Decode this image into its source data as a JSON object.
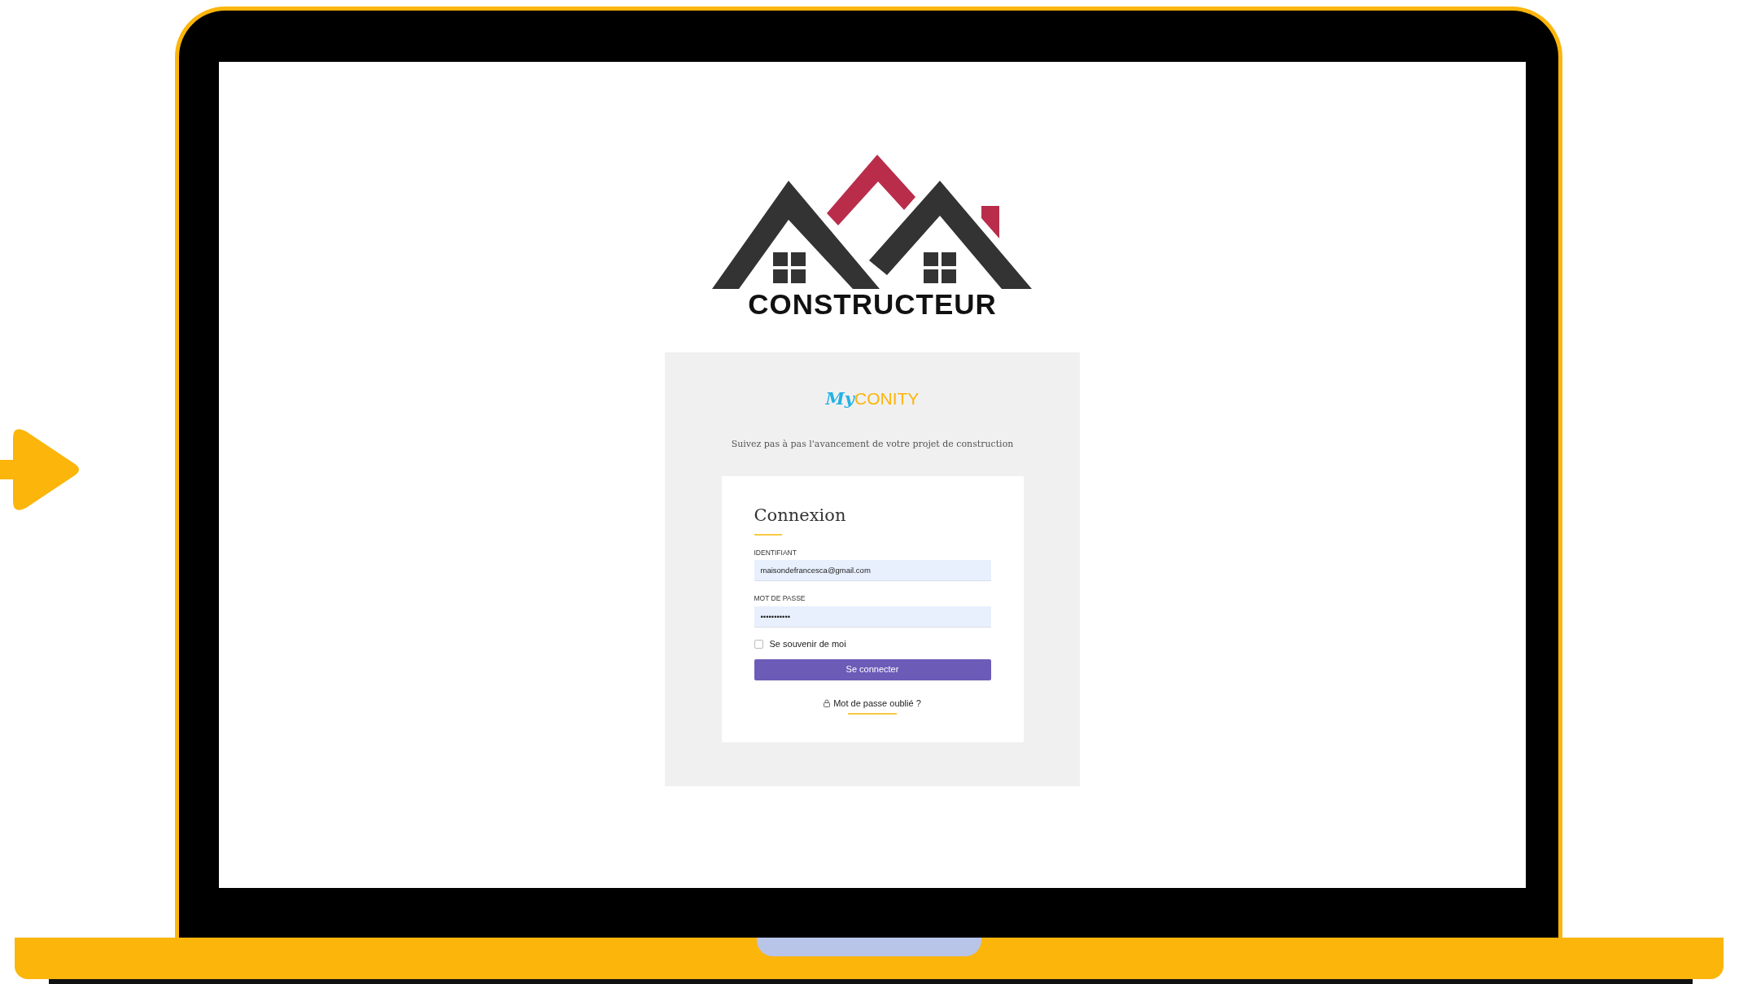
{
  "logo": {
    "name": "CONSTRUCTEUR"
  },
  "brand": {
    "prefix": "My",
    "name": "CONITY"
  },
  "tagline": "Suivez pas à pas l'avancement de votre projet de construction",
  "login": {
    "title": "Connexion",
    "fields": [
      {
        "label": "IDENTIFIANT",
        "value": "maisondefrancesca@gmail.com"
      },
      {
        "label": "MOT DE PASSE",
        "value": "•••••••••••"
      }
    ],
    "remember": {
      "label": "Se souvenir de moi",
      "checked": false
    },
    "submit": "Se connecter",
    "forgot_link": "Mot de passe oublié ?"
  }
}
